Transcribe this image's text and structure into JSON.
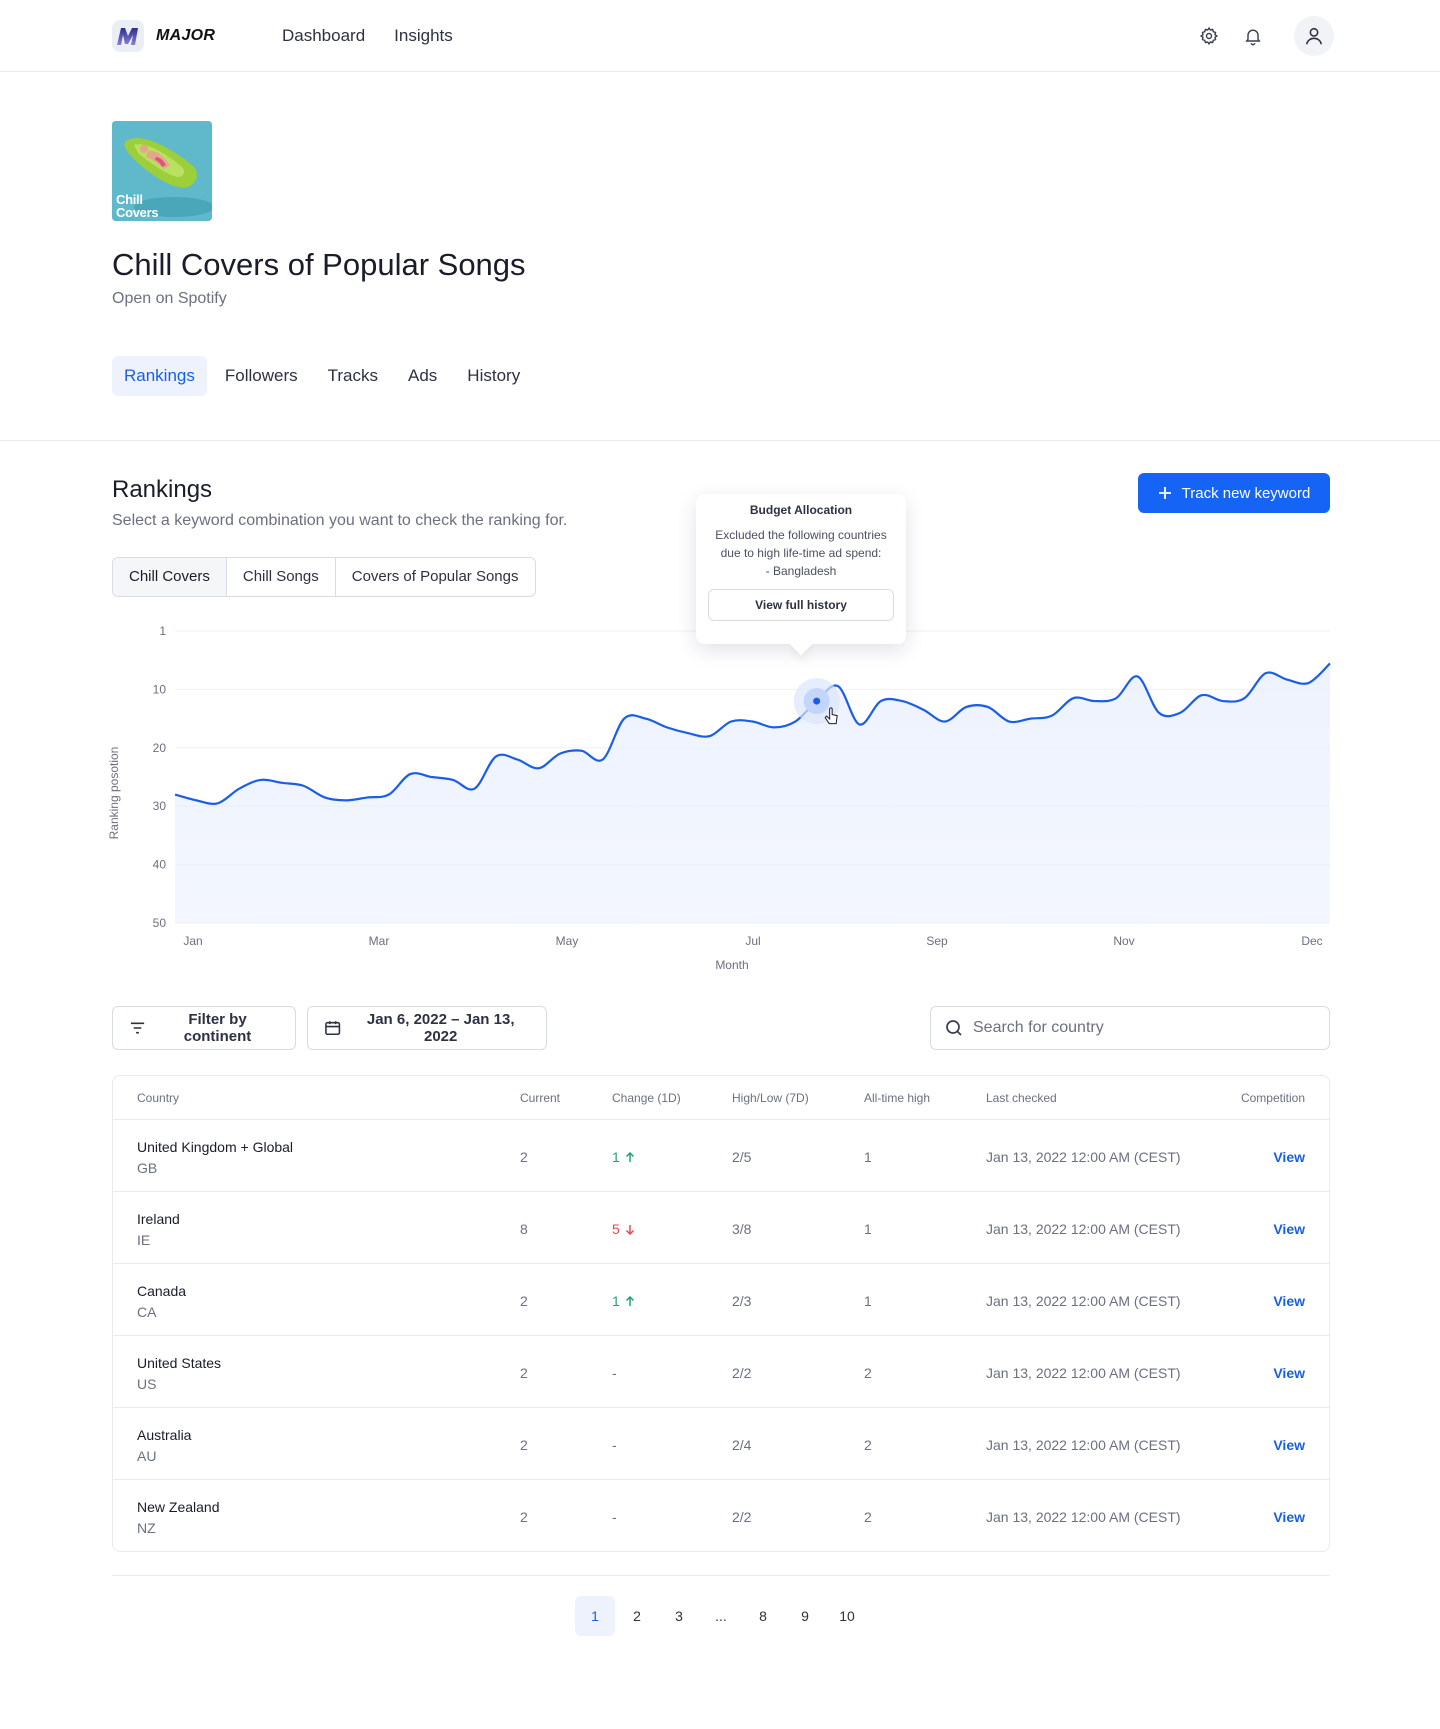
{
  "app": {
    "brand": "MAJOR",
    "nav": [
      {
        "label": "Dashboard"
      },
      {
        "label": "Insights"
      }
    ]
  },
  "playlist": {
    "cover_text_line1": "Chill",
    "cover_text_line2": "Covers",
    "title": "Chill Covers of Popular Songs",
    "link": "Open on Spotify"
  },
  "tabs": [
    {
      "label": "Rankings",
      "active": true
    },
    {
      "label": "Followers"
    },
    {
      "label": "Tracks"
    },
    {
      "label": "Ads"
    },
    {
      "label": "History"
    }
  ],
  "rankings": {
    "title": "Rankings",
    "subtitle": "Select a keyword combination you want to check the ranking for.",
    "track_button": "Track new keyword",
    "keywords": [
      {
        "label": "Chill Covers",
        "active": true
      },
      {
        "label": "Chill Songs"
      },
      {
        "label": "Covers of Popular Songs"
      }
    ]
  },
  "tooltip": {
    "title": "Budget Allocation",
    "line1": "Excluded the following countries",
    "line2": "due to high life-time ad spend:",
    "line3": "- Bangladesh",
    "button": "View full history"
  },
  "chart_data": {
    "type": "area",
    "xlabel": "Month",
    "ylabel": "Ranking posotion",
    "x_ticks": [
      "Jan",
      "Mar",
      "May",
      "Jul",
      "Sep",
      "Nov",
      "Dec"
    ],
    "y_ticks": [
      1,
      10,
      20,
      30,
      40,
      50
    ],
    "ylim": [
      50,
      1
    ],
    "y_inverted": true,
    "grid": true,
    "highlight_index": 30,
    "colors": {
      "line": "#1b5ee6",
      "fill": "#eaf0fd"
    },
    "series": [
      {
        "values": [
          28,
          29,
          29.5,
          27,
          25.5,
          26,
          26.5,
          28.5,
          29,
          28.5,
          28,
          24.5,
          25,
          25.5,
          27,
          21.5,
          22,
          23.5,
          21,
          20.5,
          22,
          15,
          15,
          16.5,
          17.5,
          18,
          15.5,
          15.5,
          16.5,
          15.5,
          12,
          9.5,
          16,
          12,
          12,
          13.5,
          15.5,
          13,
          13,
          15.5,
          15,
          14.5,
          11.5,
          12,
          11.5,
          8,
          14,
          14,
          11,
          12,
          11.5,
          7.5,
          8.5,
          9,
          6
        ]
      }
    ]
  },
  "filters": {
    "continent": "Filter by continent",
    "date_range": "Jan 6, 2022 – Jan 13, 2022",
    "search_placeholder": "Search for country"
  },
  "table": {
    "headers": {
      "country": "Country",
      "current": "Current",
      "change": "Change (1D)",
      "highlow": "High/Low (7D)",
      "ath": "All-time high",
      "last": "Last checked",
      "competition": "Competition"
    },
    "rows": [
      {
        "country": "United Kingdom + Global",
        "code": "GB",
        "current": "2",
        "change": "1",
        "dir": "up",
        "highlow": "2/5",
        "ath": "1",
        "last": "Jan 13, 2022 12:00 AM (CEST)",
        "action": "View"
      },
      {
        "country": "Ireland",
        "code": "IE",
        "current": "8",
        "change": "5",
        "dir": "down",
        "highlow": "3/8",
        "ath": "1",
        "last": "Jan 13, 2022 12:00 AM (CEST)",
        "action": "View"
      },
      {
        "country": "Canada",
        "code": "CA",
        "current": "2",
        "change": "1",
        "dir": "up",
        "highlow": "2/3",
        "ath": "1",
        "last": "Jan 13, 2022 12:00 AM (CEST)",
        "action": "View"
      },
      {
        "country": "United States",
        "code": "US",
        "current": "2",
        "change": "-",
        "dir": "none",
        "highlow": "2/2",
        "ath": "2",
        "last": "Jan 13, 2022 12:00 AM (CEST)",
        "action": "View"
      },
      {
        "country": "Australia",
        "code": "AU",
        "current": "2",
        "change": "-",
        "dir": "none",
        "highlow": "2/4",
        "ath": "2",
        "last": "Jan 13, 2022 12:00 AM (CEST)",
        "action": "View"
      },
      {
        "country": "New Zealand",
        "code": "NZ",
        "current": "2",
        "change": "-",
        "dir": "none",
        "highlow": "2/2",
        "ath": "2",
        "last": "Jan 13, 2022 12:00 AM (CEST)",
        "action": "View"
      }
    ]
  },
  "pagination": {
    "pages": [
      "1",
      "2",
      "3",
      "...",
      "8",
      "9",
      "10"
    ],
    "current": "1"
  }
}
